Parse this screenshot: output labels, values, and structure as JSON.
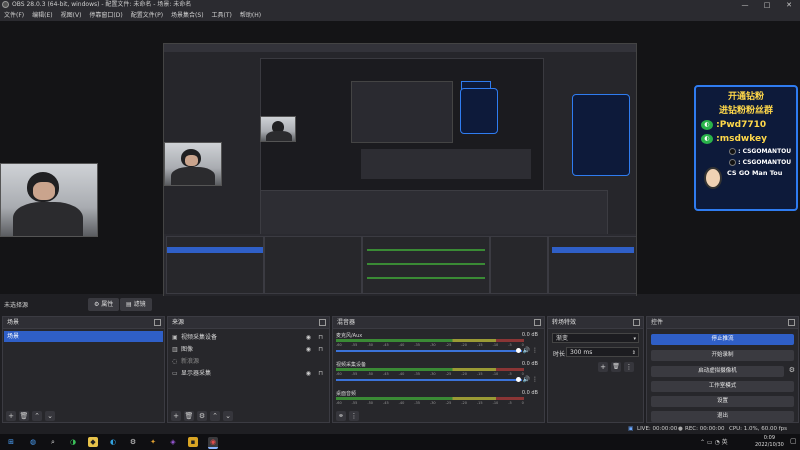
{
  "window": {
    "title": "OBS 28.0.3 (64-bit, windows) - 配置文件: 未命名 - 场景: 未命名",
    "controls": [
      "—",
      "□",
      "✕"
    ]
  },
  "menu": [
    "文件(F)",
    "编辑(E)",
    "视图(V)",
    "停靠窗口(D)",
    "配置文件(P)",
    "场景集合(S)",
    "工具(T)",
    "帮助(H)"
  ],
  "promo": {
    "line1": "开通钻粉",
    "line2": "进钻粉粉丝群",
    "line3": ":Pwd7710",
    "line4": ":msdwkey",
    "line5": ": CSGOMANTOU",
    "line6": ": CSGOMANTOU",
    "line7": "CS GO Man Tou"
  },
  "status_row": {
    "scene_label": "未选择源",
    "properties_button": "属性",
    "filters_button": "滤镜"
  },
  "scenes": {
    "title": "场景",
    "items": [
      "场景"
    ]
  },
  "sources": {
    "title": "来源",
    "items": [
      {
        "name": "视频采集设备",
        "icon": "camera-icon"
      },
      {
        "name": "图像",
        "icon": "image-icon"
      },
      {
        "name": "新浪源",
        "icon": "globe-icon"
      },
      {
        "name": "显示器采集",
        "icon": "monitor-icon"
      }
    ]
  },
  "mixer": {
    "title": "混音器",
    "channels": [
      {
        "name": "麦克风/Aux",
        "db": "0.0 dB"
      },
      {
        "name": "视频采集设备",
        "db": "0.0 dB"
      },
      {
        "name": "桌面音频",
        "db": "0.0 dB"
      }
    ],
    "ticks": [
      "-60",
      "-55",
      "-50",
      "-45",
      "-40",
      "-35",
      "-30",
      "-25",
      "-20",
      "-15",
      "-10",
      "-5",
      "0"
    ]
  },
  "transitions": {
    "title": "转场特效",
    "selected": "渐变",
    "duration_label": "时长",
    "duration_value": "300 ms"
  },
  "controls": {
    "title": "控件",
    "buttons": [
      "停止推流",
      "开始录制",
      "启动虚拟摄像机",
      "工作室模式",
      "设置",
      "退出"
    ]
  },
  "statusbar": {
    "live": "LIVE: 00:00:00",
    "rec": "REC: 00:00:00",
    "cpu": "CPU: 1.0%, 60.00 fps"
  },
  "taskbar": {
    "time": "0:09",
    "date": "2022/10/30"
  },
  "colors": {
    "accent": "#2f5fc7",
    "promo_border": "#2f7cf0",
    "promo_text": "#ffd84a"
  }
}
